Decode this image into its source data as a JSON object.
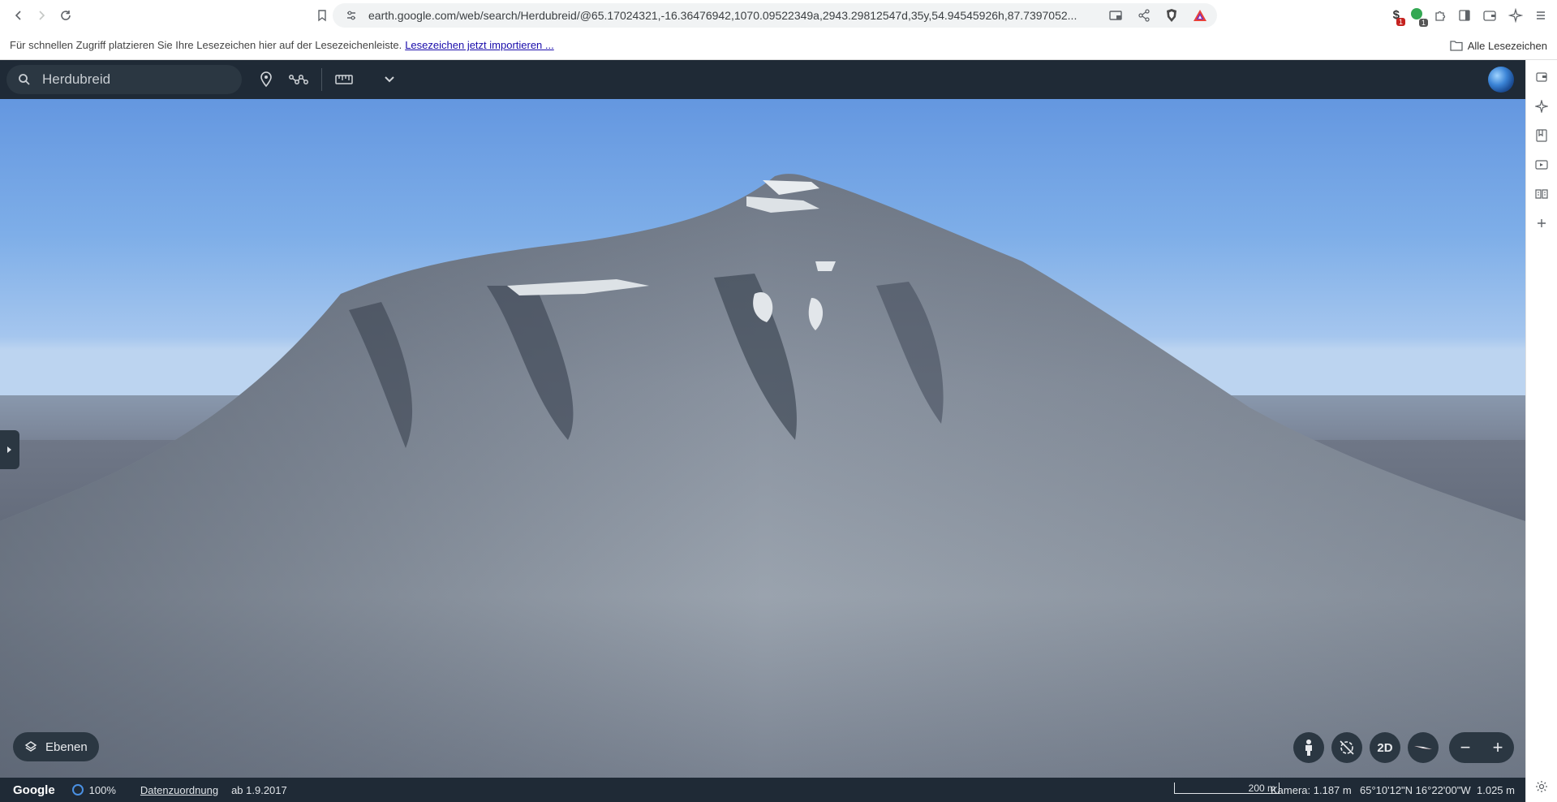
{
  "browser": {
    "url": "earth.google.com/web/search/Herdubreid/@65.17024321,-16.36476942,1070.09522349a,2943.29812547d,35y,54.94545926h,87.7397052...",
    "ext_badge_1": "1",
    "ext_badge_2": "1"
  },
  "bookmarks": {
    "prompt": "Für schnellen Zugriff platzieren Sie Ihre Lesezeichen hier auf der Lesezeichenleiste.",
    "import_link": "Lesezeichen jetzt importieren ...",
    "all_bookmarks": "Alle Lesezeichen"
  },
  "earth": {
    "search_value": "Herdubreid",
    "layers_label": "Ebenen",
    "btn_2d": "2D",
    "zoom_out": "−",
    "zoom_in": "+"
  },
  "status": {
    "logo": "Google",
    "loading": "100%",
    "attribution": "Datenzuordnung",
    "date": "ab 1.9.2017",
    "scale": "200 m",
    "camera": "Kamera: 1.187 m",
    "coords": "65°10'12\"N 16°22'00\"W",
    "elevation": "1.025 m"
  },
  "colors": {
    "toolbar_bg": "#1f2a36",
    "button_bg": "#2b3742",
    "sky_top": "#6497e0"
  }
}
